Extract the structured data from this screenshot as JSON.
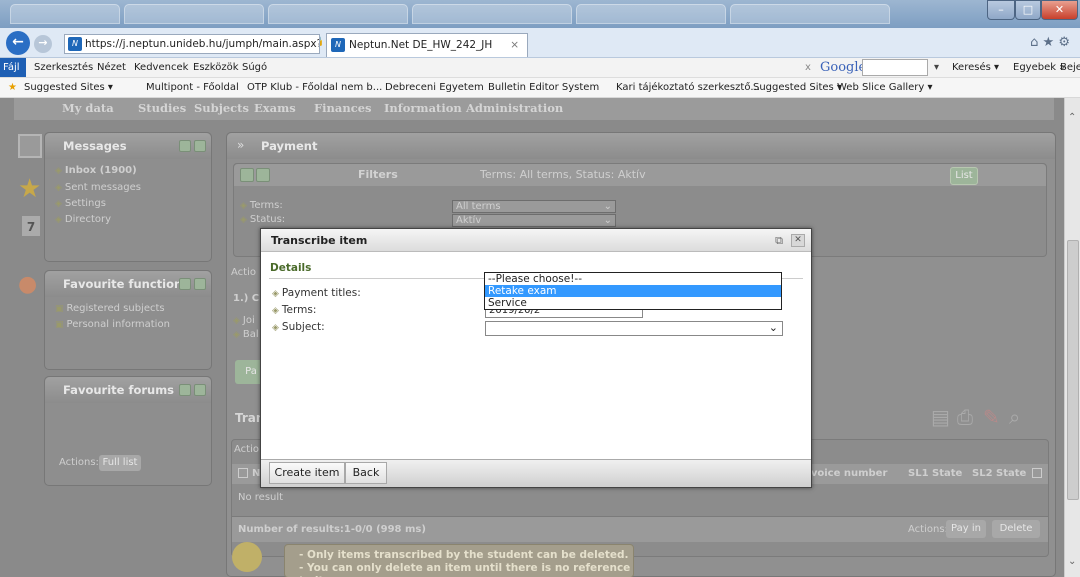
{
  "browser": {
    "address": "https://j.neptun.unideb.hu/jumph/main.aspx?isme",
    "tab_title": "Neptun.Net DE_HW_242_JH",
    "tab_close": "×",
    "search_engine": "Google",
    "search_clear": "x",
    "menu": [
      "Fájl",
      "Szerkesztés",
      "Nézet",
      "Kedvencek",
      "Eszközök",
      "Súgó"
    ],
    "right_menu": [
      "Keresés ▾",
      "Egyebek »",
      "Bejelentk"
    ],
    "favorites": [
      "Suggested Sites ▾",
      "Multipont - Főoldal",
      "OTP Klub - Főoldal nem b...",
      "Debreceni Egyetem",
      "Bulletin Editor System",
      "Kari tájékoztató szerkesztő...",
      "Suggested Sites ▾",
      "Web Slice Gallery ▾"
    ]
  },
  "nav": [
    "My data",
    "Studies",
    "Subjects",
    "Exams",
    "Finances",
    "Information",
    "Administration"
  ],
  "messages": {
    "title": "Messages",
    "items": [
      "Inbox (1900)",
      "Sent messages",
      "Settings",
      "Directory"
    ]
  },
  "calendar_day": "7",
  "favourite_functions": {
    "title": "Favourite functions",
    "items": [
      "Registered subjects",
      "Personal information"
    ]
  },
  "favourite_forums": {
    "title": "Favourite forums",
    "actions_label": "Actions:",
    "full_list": "Full list"
  },
  "payment": {
    "title": "Payment",
    "filters_label": "Filters",
    "filter_summary": "Terms: All terms, Status: Aktív",
    "list_button": "List",
    "terms_label": "Terms:",
    "terms_value": "All terms",
    "status_label": "Status:",
    "status_value": "Aktív",
    "actions_label": "Actio",
    "section_label": "1.) Cl",
    "row_label_1": "Joi",
    "row_label_2": "Bal",
    "pa_button": "Pa",
    "tran_label": "Tran",
    "actio2": "Actio",
    "n_col": "N",
    "col_invoice": "Invoice number",
    "col_sl1": "SL1 State",
    "col_sl2": "SL2 State",
    "no_result": "No result",
    "number_of_results": "Number of results:1-0/0 (998 ms)",
    "actions_bottom": "Actions:",
    "pay_in": "Pay in",
    "delete": "Delete",
    "note_line1": "- Only items transcribed by the student can be deleted.",
    "note_line2": "- You can only delete an item until there is no reference to it."
  },
  "dialog": {
    "title": "Transcribe item",
    "section": "Details",
    "labels": {
      "payment_titles": "Payment titles:",
      "terms": "Terms:",
      "subject": "Subject:"
    },
    "terms_value_partial": "2019/20/2",
    "payment_title_options": [
      "--Please choose!--",
      "Retake exam",
      "Service"
    ],
    "selected_option": "Retake exam",
    "create_button": "Create item",
    "back_button": "Back"
  }
}
